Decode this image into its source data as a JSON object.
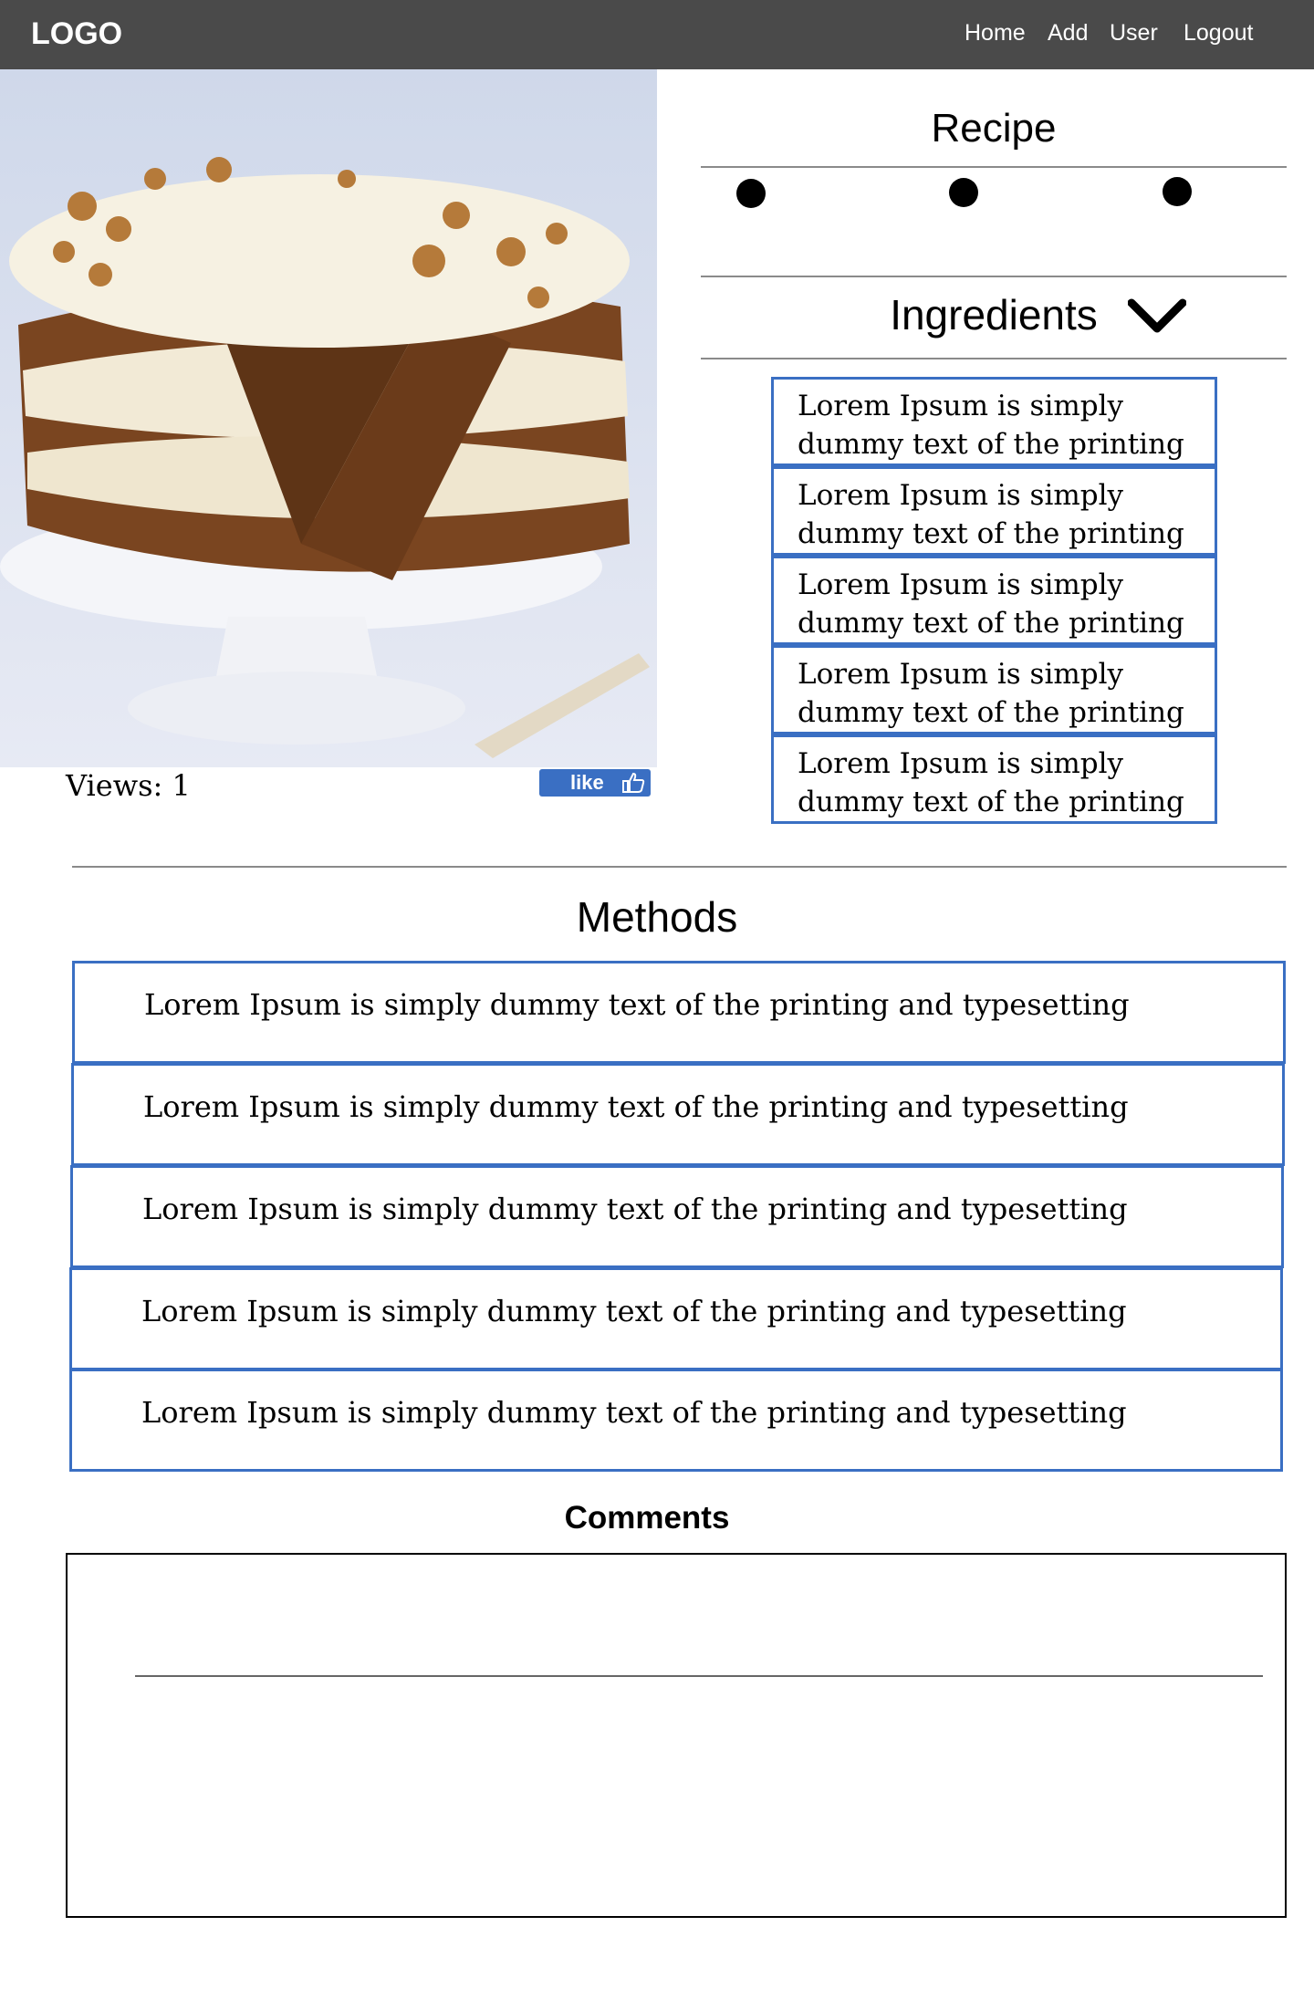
{
  "navbar": {
    "logo": "LOGO",
    "links": [
      "Home",
      "Add",
      "User",
      "Logout"
    ]
  },
  "hero": {
    "views_text": "Views: 1",
    "like_label": "like",
    "like_icon": "thumbs-up-icon"
  },
  "recipe": {
    "title": "Recipe",
    "carousel_dots": 3
  },
  "ingredients": {
    "title": "Ingredients",
    "toggle_icon": "chevron-down-icon",
    "items": [
      "Lorem Ipsum is simply dummy text of the printing",
      "Lorem Ipsum is simply dummy text of the printing",
      "Lorem Ipsum is simply dummy text of the printing",
      "Lorem Ipsum is simply dummy text of the printing",
      "Lorem Ipsum is simply dummy text of the printing"
    ]
  },
  "methods": {
    "title": "Methods",
    "items": [
      "Lorem Ipsum is simply dummy text of the printing and typesetting",
      "Lorem Ipsum is simply dummy text of the printing and typesetting",
      "Lorem Ipsum is simply dummy text of the printing and typesetting",
      "Lorem Ipsum is simply dummy text of the printing and typesetting",
      "Lorem Ipsum is simply dummy text of the printing and typesetting"
    ]
  },
  "comments": {
    "title": "Comments"
  },
  "colors": {
    "navbar": "#4a4a4a",
    "accent": "#3a6fc3",
    "divider": "#8a8a8a"
  }
}
